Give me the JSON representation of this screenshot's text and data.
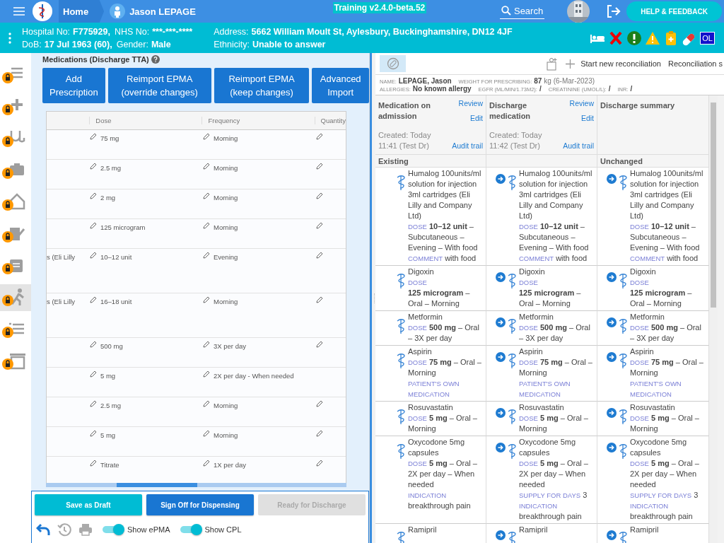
{
  "header": {
    "home": "Home",
    "user": "Jason LEPAGE",
    "environment": "Training v2.4.0-beta.52",
    "search": "Search",
    "help": "HELP & FEEDBACK"
  },
  "patient_bar": {
    "lines_left": [
      [
        {
          "label": "Hospital No:",
          "value": "F775929,"
        },
        {
          "label": "NHS No:",
          "value": "***-***-****"
        }
      ],
      [
        {
          "label": "DoB:",
          "value": "17 Jul 1963 (60),"
        },
        {
          "label": "Gender:",
          "value": "Male"
        }
      ]
    ],
    "lines_right": [
      [
        {
          "label": "Address:",
          "value": "5662 William Moult St, Aylesbury, Buckinghamshire, DN12 4JF"
        }
      ],
      [
        {
          "label": "Ethnicity:",
          "value": "Unable to answer"
        }
      ]
    ],
    "alerts": [
      {
        "kind": "bed"
      },
      {
        "kind": "cross"
      },
      {
        "kind": "exclamation"
      },
      {
        "kind": "warning"
      },
      {
        "kind": "clipboard"
      },
      {
        "kind": "pill"
      },
      {
        "kind": "badge",
        "text": "OL"
      }
    ]
  },
  "sidebar": {
    "items": [
      {
        "kind": "list",
        "selected": false
      },
      {
        "kind": "plus",
        "selected": false
      },
      {
        "kind": "stethoscope",
        "selected": false
      },
      {
        "kind": "camera",
        "selected": false
      },
      {
        "kind": "house",
        "selected": false
      },
      {
        "kind": "edit",
        "selected": false
      },
      {
        "kind": "clipboard",
        "selected": false
      },
      {
        "kind": "walker",
        "selected": true
      },
      {
        "kind": "checklist",
        "selected": false
      },
      {
        "kind": "board",
        "selected": false
      }
    ]
  },
  "medications": {
    "title": "Medications (Discharge TTA)",
    "buttons": [
      "Add Prescription",
      "Reimport EPMA (override changes)",
      "Reimport EPMA (keep changes)",
      "Advanced Import"
    ],
    "columns": [
      "Dose",
      "Frequency",
      "Quantity"
    ],
    "rows": [
      {
        "dose": "75 mg",
        "frequency": "Morning",
        "quantity_editable": true
      },
      {
        "dose": "2.5 mg",
        "frequency": "Morning",
        "quantity_editable": true
      },
      {
        "dose": "2 mg",
        "frequency": "Morning",
        "quantity_editable": true
      },
      {
        "dose": "125 microgram",
        "frequency": "Morning",
        "quantity_editable": true
      },
      {
        "name": "s (Eli Lilly",
        "dose": "10–12 unit",
        "frequency": "Evening",
        "quantity_editable": true,
        "tall": true
      },
      {
        "name": "s (Eli Lilly",
        "dose": "16–18 unit",
        "frequency": "Morning",
        "quantity_editable": true,
        "tall": true
      },
      {
        "dose": "500 mg",
        "frequency": "3X per day",
        "quantity_editable": true
      },
      {
        "dose": "5 mg",
        "frequency": "2X per day - When needed",
        "quantity_editable": false
      },
      {
        "dose": "2.5 mg",
        "frequency": "Morning",
        "quantity_editable": true
      },
      {
        "dose": "5 mg",
        "frequency": "Morning",
        "quantity_editable": true
      },
      {
        "dose": "Titrate",
        "frequency": "1X per day",
        "quantity_editable": true
      }
    ],
    "actions": [
      {
        "label": "Save as Draft",
        "kind": "secondary",
        "disabled": false
      },
      {
        "label": "Sign Off for Dispensing",
        "kind": "primary",
        "disabled": false
      },
      {
        "label": "Ready for Discharge",
        "kind": "primary",
        "disabled": true
      }
    ],
    "toggles": [
      {
        "label": "Show ePMA",
        "on": true
      },
      {
        "label": "Show CPL",
        "on": true
      }
    ]
  },
  "reconciliation": {
    "toolbar": {
      "new": "Start new reconciliation",
      "status": "Reconciliation s"
    },
    "info": [
      [
        {
          "label": "NAME:",
          "value": "LEPAGE, Jason"
        },
        {
          "label": "WEIGHT FOR PRESCRIBING:",
          "value": "87",
          "unit": "kg (6-Mar-2023)"
        }
      ],
      [
        {
          "label": "ALLERGIES:",
          "value": "No known allergy"
        },
        {
          "label": "EGFR (ML/MIN/1.73M2):",
          "value": "/"
        },
        {
          "label": "CREATININE (UMOL/L):",
          "value": "/"
        },
        {
          "label": "INR:",
          "value": "/"
        }
      ]
    ],
    "columns": [
      {
        "title": "Medication on admission",
        "review": "Review",
        "edit": "Edit",
        "created": "Created: Today 11:41 (Test Dr)",
        "audit": "Audit trail",
        "section": "Existing"
      },
      {
        "title": "Discharge medication",
        "review": "Review",
        "edit": "Edit",
        "created": "Created: Today 11:42 (Test Dr)",
        "audit": "Audit trail"
      },
      {
        "title": "Discharge summary",
        "section": "Unchanged"
      }
    ],
    "rows": [
      [
        {
          "name": "Humalog 100units/ml solution for injection 3ml cartridges (Eli Lilly and Company Ltd)",
          "arrow": false,
          "details": [
            {
              "label": "DOSE",
              "text": "**10–12 unit** – Subcutaneous – Evening – With food"
            },
            {
              "label": "COMMENT",
              "text": "with food"
            }
          ]
        },
        {
          "name": "Humalog 100units/ml solution for injection 3ml cartridges (Eli Lilly and Company Ltd)",
          "arrow": true,
          "details": [
            {
              "label": "DOSE",
              "text": "**10–12 unit** – Subcutaneous – Evening – With food"
            },
            {
              "label": "COMMENT",
              "text": "with food"
            }
          ]
        },
        {
          "name": "Humalog 100units/ml solution for injection 3ml cartridges (Eli Lilly and Company Ltd)",
          "arrow": true,
          "details": [
            {
              "label": "DOSE",
              "text": "**10–12 unit** – Subcutaneous – Evening – With food"
            },
            {
              "label": "COMMENT",
              "text": "with food"
            }
          ]
        }
      ],
      [
        {
          "name": "Digoxin",
          "arrow": false,
          "details": [
            {
              "label": "DOSE"
            },
            {
              "text": "**125 microgram** – Oral – Morning"
            }
          ]
        },
        {
          "name": "Digoxin",
          "arrow": true,
          "details": [
            {
              "label": "DOSE"
            },
            {
              "text": "**125 microgram** – Oral – Morning"
            }
          ]
        },
        {
          "name": "Digoxin",
          "arrow": true,
          "details": [
            {
              "label": "DOSE"
            },
            {
              "text": "**125 microgram** – Oral – Morning"
            }
          ]
        }
      ],
      [
        {
          "name": "Metformin",
          "arrow": false,
          "details": [
            {
              "label": "DOSE",
              "text": "**500 mg** – Oral – 3X per day"
            }
          ]
        },
        {
          "name": "Metformin",
          "arrow": true,
          "details": [
            {
              "label": "DOSE",
              "text": "**500 mg** – Oral – 3X per day"
            }
          ]
        },
        {
          "name": "Metformin",
          "arrow": true,
          "details": [
            {
              "label": "DOSE",
              "text": "**500 mg** – Oral – 3X per day"
            }
          ]
        }
      ],
      [
        {
          "name": "Aspirin",
          "arrow": false,
          "details": [
            {
              "label": "DOSE",
              "text": "**75 mg** – Oral – Morning"
            },
            {
              "label": "PATIENT'S OWN MEDICATION"
            }
          ]
        },
        {
          "name": "Aspirin",
          "arrow": true,
          "details": [
            {
              "label": "DOSE",
              "text": "**75 mg** – Oral – Morning"
            },
            {
              "label": "PATIENT'S OWN MEDICATION"
            }
          ]
        },
        {
          "name": "Aspirin",
          "arrow": true,
          "details": [
            {
              "label": "DOSE",
              "text": "**75 mg** – Oral – Morning"
            },
            {
              "label": "PATIENT'S OWN MEDICATION"
            }
          ]
        }
      ],
      [
        {
          "name": "Rosuvastatin",
          "arrow": false,
          "details": [
            {
              "label": "DOSE",
              "text": "**5 mg** – Oral – Morning"
            }
          ]
        },
        {
          "name": "Rosuvastatin",
          "arrow": true,
          "details": [
            {
              "label": "DOSE",
              "text": "**5 mg** – Oral – Morning"
            }
          ]
        },
        {
          "name": "Rosuvastatin",
          "arrow": true,
          "details": [
            {
              "label": "DOSE",
              "text": "**5 mg** – Oral – Morning"
            }
          ]
        }
      ],
      [
        {
          "name": "Oxycodone 5mg capsules",
          "arrow": false,
          "details": [
            {
              "label": "DOSE",
              "text": "**5 mg** – Oral – 2X per day – When needed"
            },
            {
              "label": "INDICATION"
            },
            {
              "text": "breakthrough pain"
            }
          ]
        },
        {
          "name": "Oxycodone 5mg capsules",
          "arrow": true,
          "details": [
            {
              "label": "DOSE",
              "text": "**5 mg** – Oral – 2X per day – When needed"
            },
            {
              "label": "SUPPLY FOR DAYS",
              "text": "3"
            },
            {
              "label": "INDICATION"
            },
            {
              "text": "breakthrough pain"
            }
          ]
        },
        {
          "name": "Oxycodone 5mg capsules",
          "arrow": true,
          "details": [
            {
              "label": "DOSE",
              "text": "**5 mg** – Oral – 2X per day – When needed"
            },
            {
              "label": "SUPPLY FOR DAYS",
              "text": "3"
            },
            {
              "label": "INDICATION"
            },
            {
              "text": "breakthrough pain"
            }
          ]
        }
      ],
      [
        {
          "name": "Ramipril",
          "arrow": false
        },
        {
          "name": "Ramipril",
          "arrow": true
        },
        {
          "name": "Ramipril",
          "arrow": true
        }
      ]
    ]
  }
}
